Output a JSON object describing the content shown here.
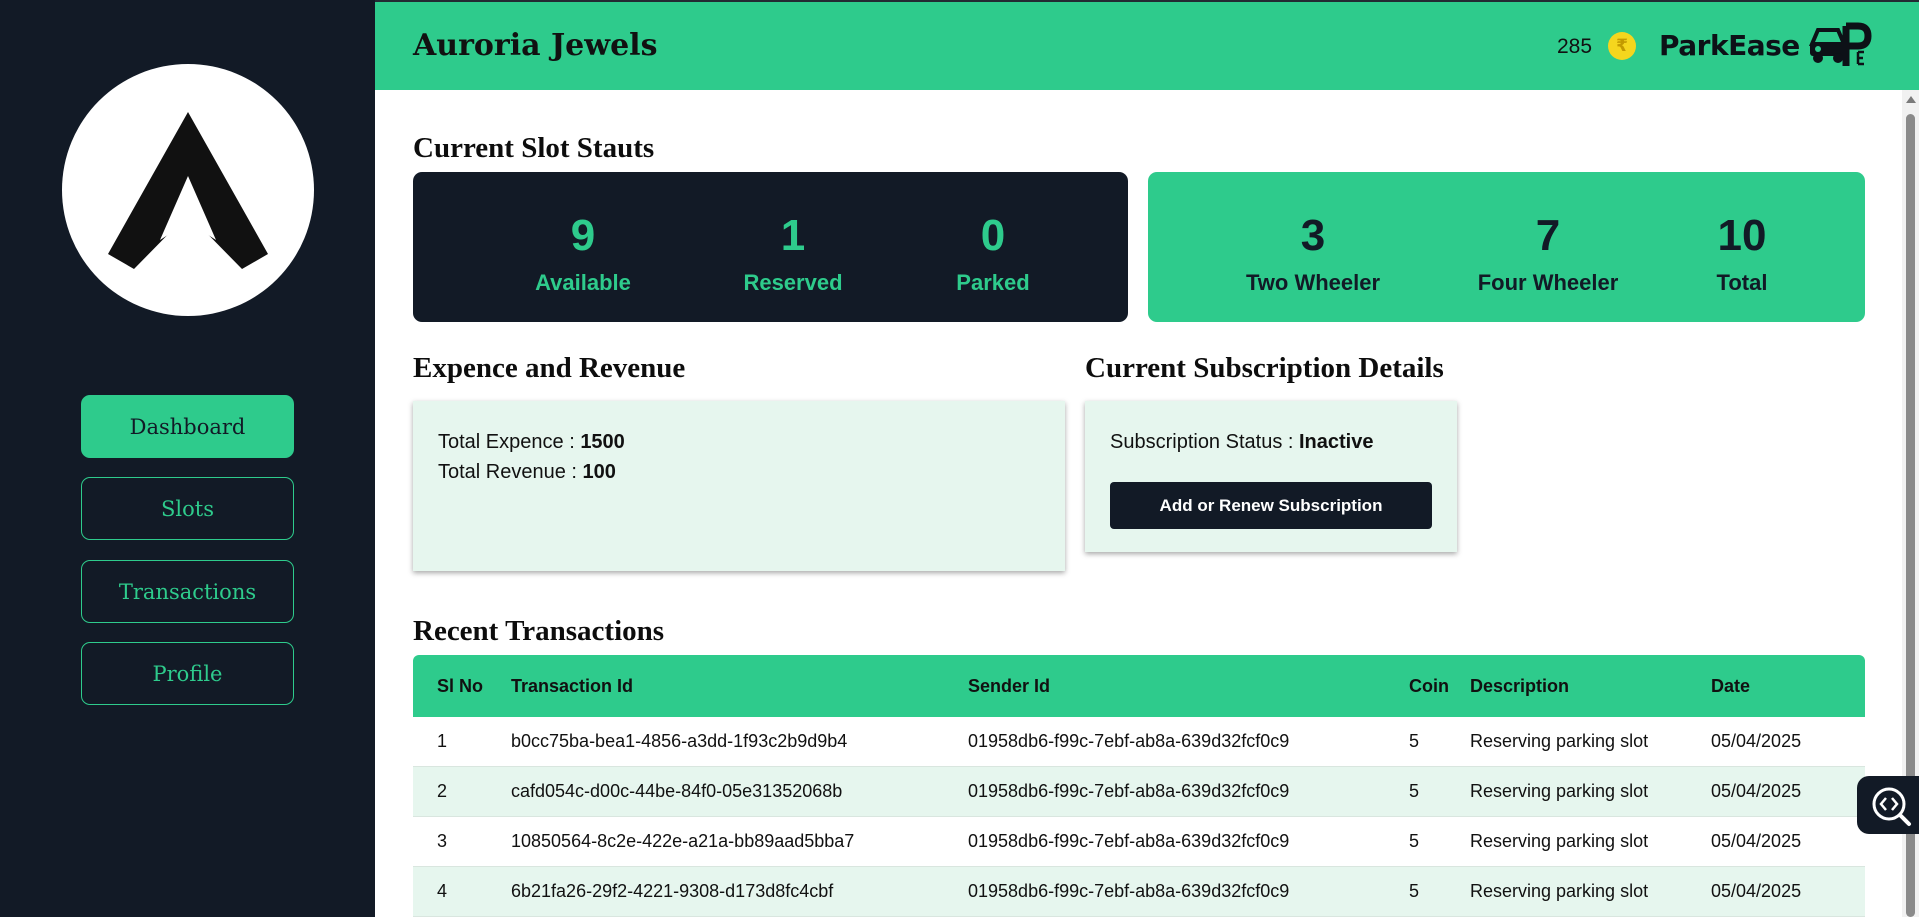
{
  "sidebar": {
    "nav": [
      {
        "label": "Dashboard",
        "active": true
      },
      {
        "label": "Slots",
        "active": false
      },
      {
        "label": "Transactions",
        "active": false
      },
      {
        "label": "Profile",
        "active": false
      }
    ]
  },
  "header": {
    "company_name": "Auroria Jewels",
    "coin_balance": "285",
    "coin_symbol": "₹",
    "app_name": "ParkEase"
  },
  "slot_status": {
    "title": "Current Slot Stauts",
    "occupancy": [
      {
        "value": "9",
        "label": "Available"
      },
      {
        "value": "1",
        "label": "Reserved"
      },
      {
        "value": "0",
        "label": "Parked"
      }
    ],
    "capacity": [
      {
        "value": "3",
        "label": "Two Wheeler"
      },
      {
        "value": "7",
        "label": "Four Wheeler"
      },
      {
        "value": "10",
        "label": "Total"
      }
    ]
  },
  "expense_revenue": {
    "title": "Expence and Revenue",
    "expense_label": "Total Expence : ",
    "expense_value": "1500",
    "revenue_label": "Total Revenue : ",
    "revenue_value": "100"
  },
  "subscription": {
    "title": "Current Subscription Details",
    "status_label": "Subscription Status : ",
    "status_value": "Inactive",
    "button_label": "Add or Renew Subscription"
  },
  "transactions": {
    "title": "Recent Transactions",
    "columns": [
      "Sl No",
      "Transaction Id",
      "Sender Id",
      "Coin",
      "Description",
      "Date"
    ],
    "rows": [
      [
        "1",
        "b0cc75ba-bea1-4856-a3dd-1f93c2b9d9b4",
        "01958db6-f99c-7ebf-ab8a-639d32fcf0c9",
        "5",
        "Reserving parking slot",
        "05/04/2025"
      ],
      [
        "2",
        "cafd054c-d00c-44be-84f0-05e31352068b",
        "01958db6-f99c-7ebf-ab8a-639d32fcf0c9",
        "5",
        "Reserving parking slot",
        "05/04/2025"
      ],
      [
        "3",
        "10850564-8c2e-422e-a21a-bb89aad5bba7",
        "01958db6-f99c-7ebf-ab8a-639d32fcf0c9",
        "5",
        "Reserving parking slot",
        "05/04/2025"
      ],
      [
        "4",
        "6b21fa26-29f2-4221-9308-d173d8fc4cbf",
        "01958db6-f99c-7ebf-ab8a-639d32fcf0c9",
        "5",
        "Reserving parking slot",
        "05/04/2025"
      ]
    ]
  },
  "colors": {
    "accent": "#2ecb8c",
    "dark": "#121a26",
    "panel_bg": "#e6f6ee",
    "coin": "#f5d61e"
  }
}
